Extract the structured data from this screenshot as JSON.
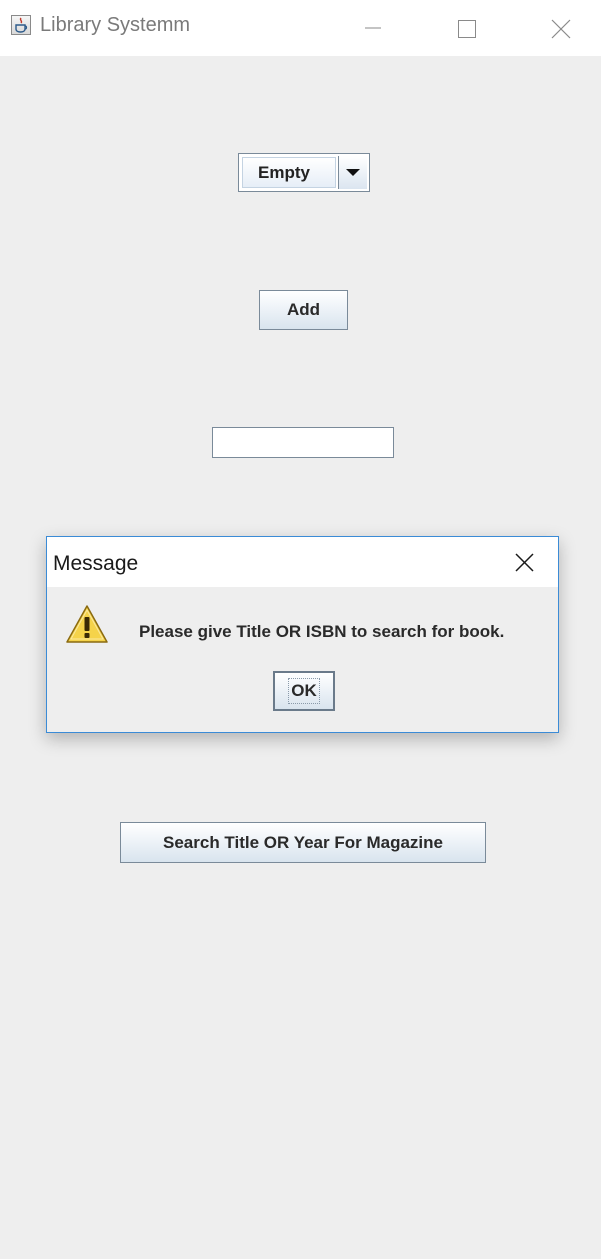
{
  "window": {
    "title": "Library Systemm",
    "controls": {
      "minimize": "minimize-icon",
      "maximize": "maximize-icon",
      "close": "close-icon"
    }
  },
  "form": {
    "combo_selected": "Empty",
    "add_label": "Add",
    "text_field_value": "",
    "search_magazine_label": "Search Title OR Year For Magazine"
  },
  "dialog": {
    "title": "Message",
    "icon": "warning-icon",
    "message": "Please give Title OR ISBN to search for book.",
    "ok_label": "OK"
  },
  "colors": {
    "background": "#eeeeee",
    "dialog_border": "#3b8bd6",
    "warning_yellow": "#f5d34a"
  }
}
